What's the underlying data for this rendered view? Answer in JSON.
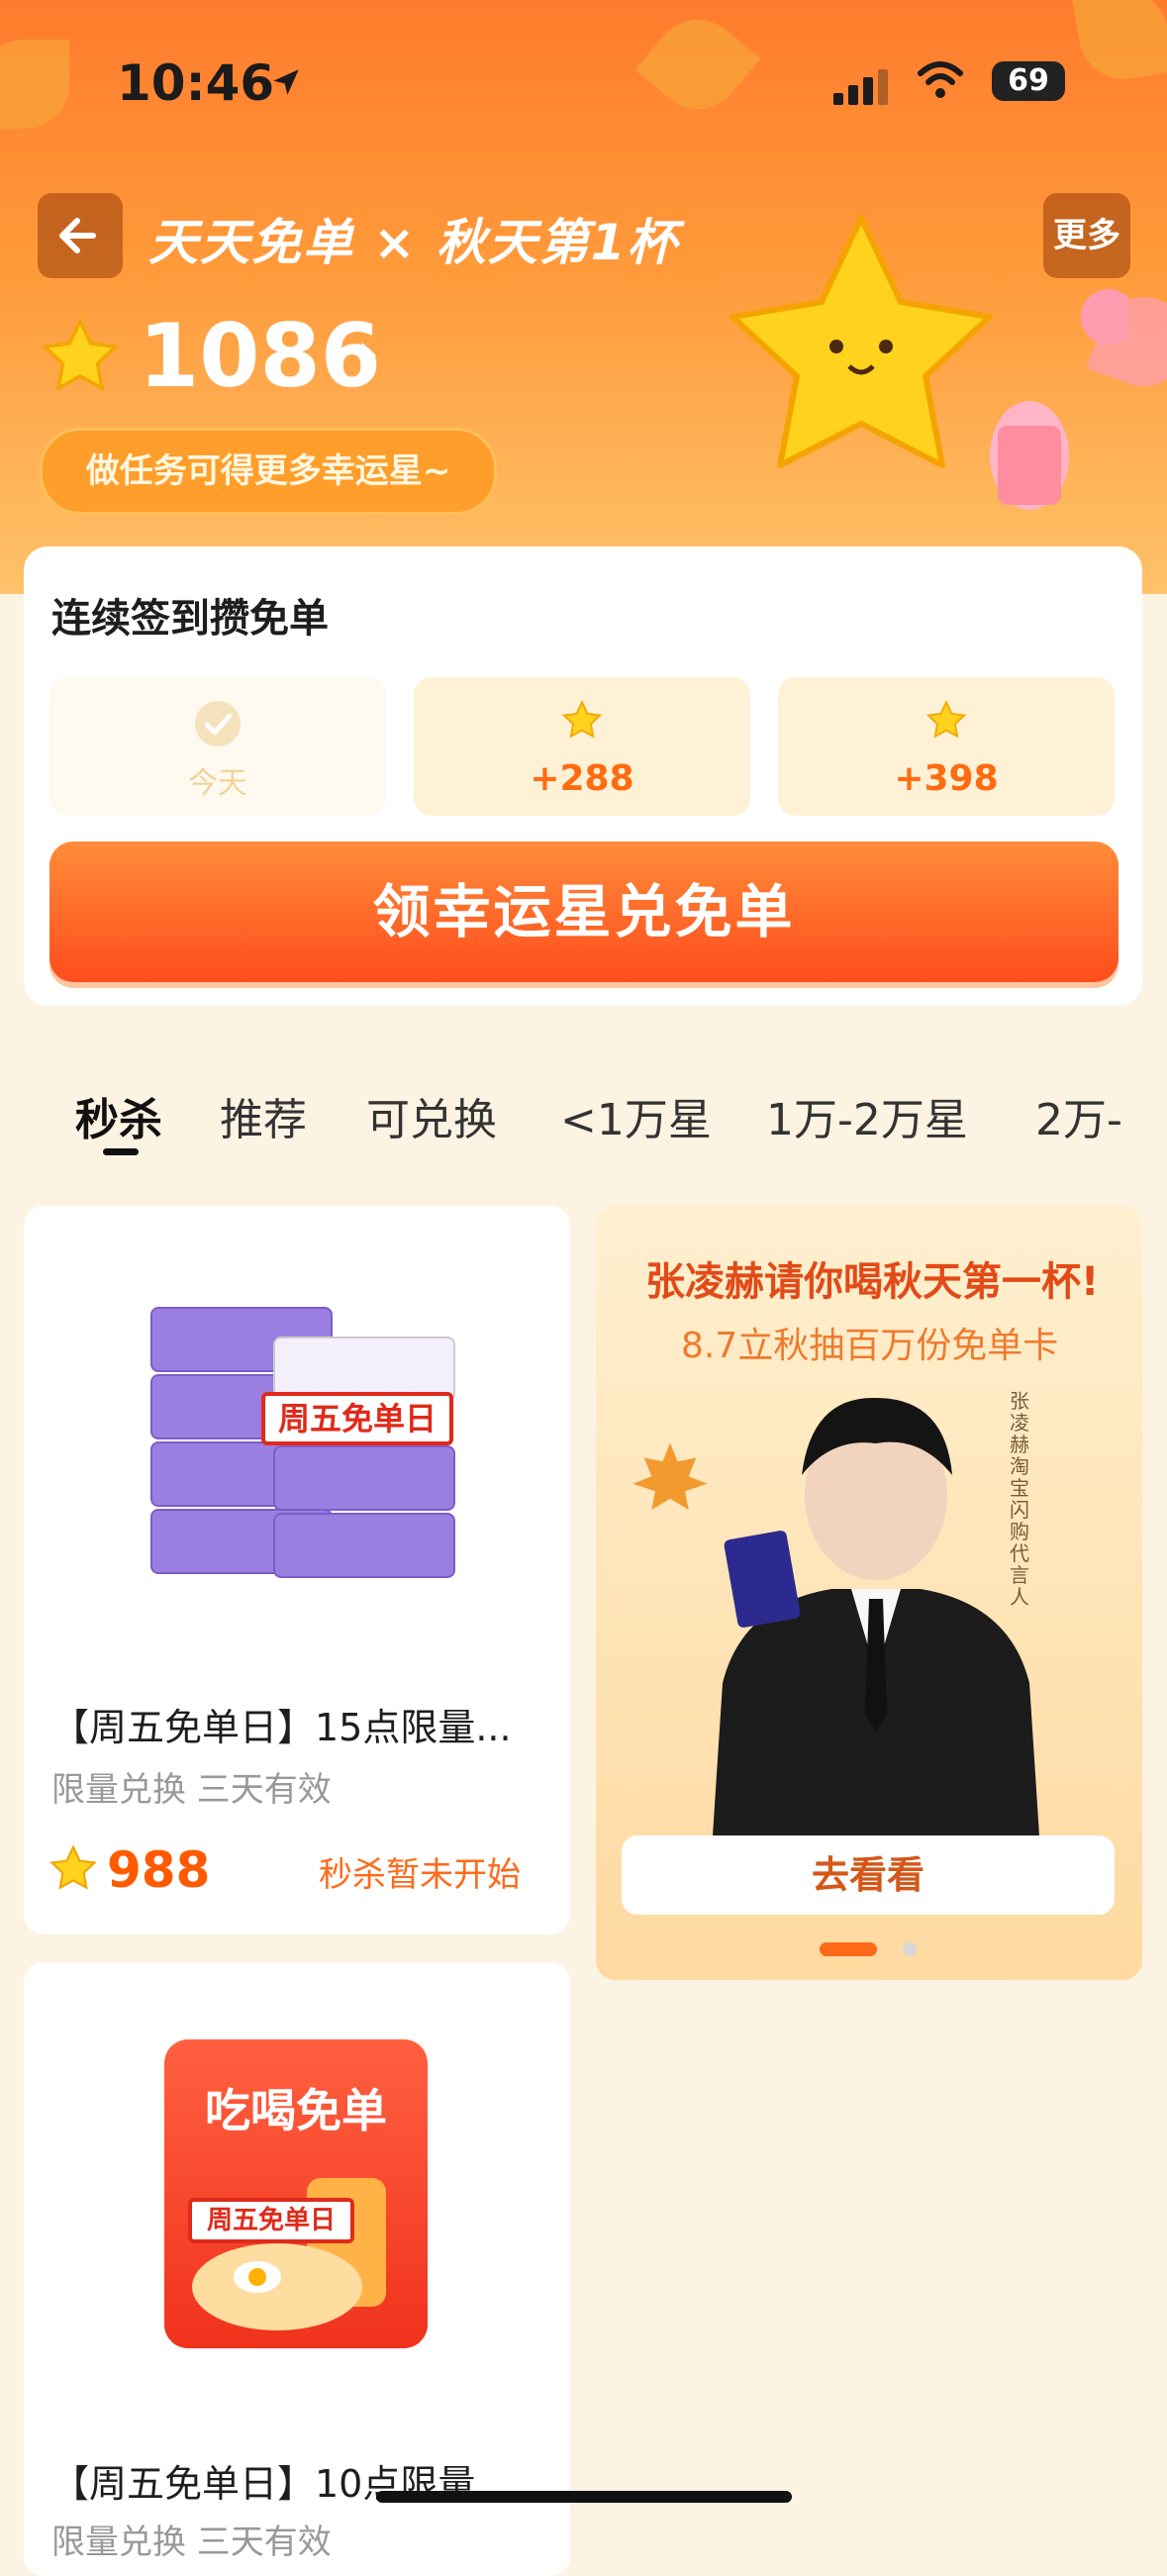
{
  "status_bar": {
    "time": "10:46",
    "battery": "69"
  },
  "header": {
    "title": "天天免单 × 秋天第1杯",
    "more_label": "更多",
    "points": "1086",
    "task_hint": "做任务可得更多幸运星~"
  },
  "signin": {
    "title": "连续签到攒免单",
    "days": [
      {
        "label": "今天",
        "done": true
      },
      {
        "label": "+288",
        "done": false
      },
      {
        "label": "+398",
        "done": false
      }
    ],
    "claim_button": "领幸运星兑免单"
  },
  "tabs": [
    "秒杀",
    "推荐",
    "可兑换",
    "<1万星",
    "1万-2万星",
    "2万-"
  ],
  "products": [
    {
      "name": "【周五免单日】15点限量...",
      "sub": "限量兑换 三天有效",
      "price": "988",
      "status": "秒杀暂未开始",
      "badge": "周五免单日"
    },
    {
      "name": "【周五免单日】10点限量...",
      "sub": "限量兑换 三天有效",
      "image_title": "吃喝免单",
      "badge": "周五免单日"
    }
  ],
  "promo": {
    "title": "张凌赫请你喝秋天第一杯!",
    "subtitle": "8.7立秋抽百万份免单卡",
    "side_text": "张凌赫 淘宝闪购代言人",
    "button": "去看看"
  },
  "colors": {
    "accent": "#ff5a00",
    "header_top": "#ff7b2d",
    "claim": "#ff4d1c"
  }
}
